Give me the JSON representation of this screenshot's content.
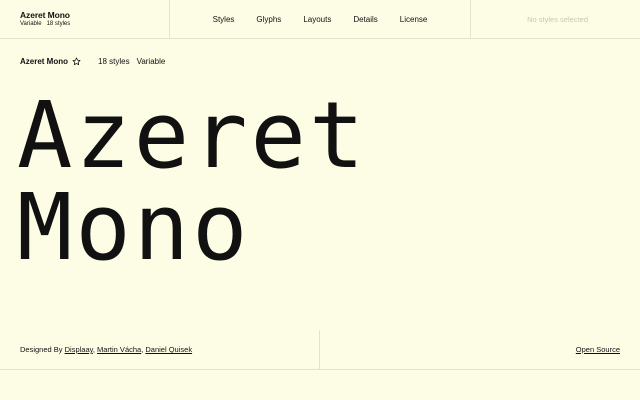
{
  "brand": {
    "name": "Azeret Mono",
    "meta_type": "Variable",
    "meta_count": "18 styles"
  },
  "nav": {
    "items": [
      "Styles",
      "Glyphs",
      "Layouts",
      "Details",
      "License"
    ]
  },
  "selection": {
    "status": "No styles selected"
  },
  "subheader": {
    "name": "Azeret Mono",
    "star_icon": "star-outline-icon",
    "styles": "18 styles",
    "type": "Variable"
  },
  "specimen": {
    "line1": "Azeret",
    "line2": "Mono"
  },
  "footer": {
    "designed_by_label": "Designed By",
    "designers": [
      "Displaay",
      "Martin Vácha",
      "Daniel Quisek"
    ],
    "separator": ",",
    "license_link": "Open Source"
  },
  "colors": {
    "background": "#fdfde6",
    "text": "#111111",
    "muted": "#c8c8b0",
    "divider": "#e4e4cc"
  }
}
